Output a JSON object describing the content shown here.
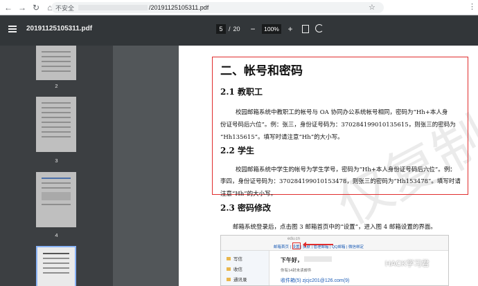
{
  "browser": {
    "back": "←",
    "forward": "→",
    "reload": "↻",
    "home": "⌂",
    "security_label": "不安全",
    "url_tail": "/20191125105311.pdf",
    "star": "☆",
    "menu": "⋮"
  },
  "toolbar": {
    "title": "20191125105311.pdf",
    "current_page": "5",
    "page_sep": "/",
    "total_pages": "20",
    "zoom_out": "−",
    "zoom": "100%",
    "zoom_in": "+"
  },
  "sidebar": {
    "thumbnails": [
      {
        "label": "2"
      },
      {
        "label": "3"
      },
      {
        "label": "4"
      },
      {
        "label": ""
      }
    ]
  },
  "document": {
    "heading": "二、帐号和密码",
    "sections": [
      {
        "title": "2.1  教职工",
        "lines": [
          "校园邮箱系统中教职工的帐号与  OA  协同办公系统帐号相同，密码为“Hh+本人身",
          "份证号码后六位”。例：张三，身份证号码为：370284199010135615，则张三的密码为",
          "“Hh135615”。填写时请注意“Hh”的大小写。"
        ]
      },
      {
        "title": "2.2  学生",
        "lines": [
          "校园邮箱系统中学生的帐号为学生学号，密码为“Hh+本人身份证号码后六位”。例：",
          "李四，身份证号码为：370284199010153478，则张三的密码为“Hh153478”。填写时请",
          "注意“Hh”的大小写。"
        ]
      },
      {
        "title": "2.3  密码修改",
        "lines": [
          "邮箱系统登录后，点击图 3 邮箱首页中的“设置”，进入图 4 邮箱设置的界面。"
        ]
      }
    ],
    "watermark": "仅复制"
  },
  "embedded": {
    "logo": "edu.cn",
    "tabs": "邮箱首页 | 设置 | 换肤 | 管理邮箱 | QQ邮箱 | 微信绑定",
    "left_items": [
      "写信",
      "收信",
      "通讯录"
    ],
    "greeting": "下午好，",
    "unread": "你有14封未读邮件",
    "inbox": "收件箱(5)  zjcjc201@126.com(9)"
  },
  "wechat": {
    "label": "HACK学习君"
  }
}
